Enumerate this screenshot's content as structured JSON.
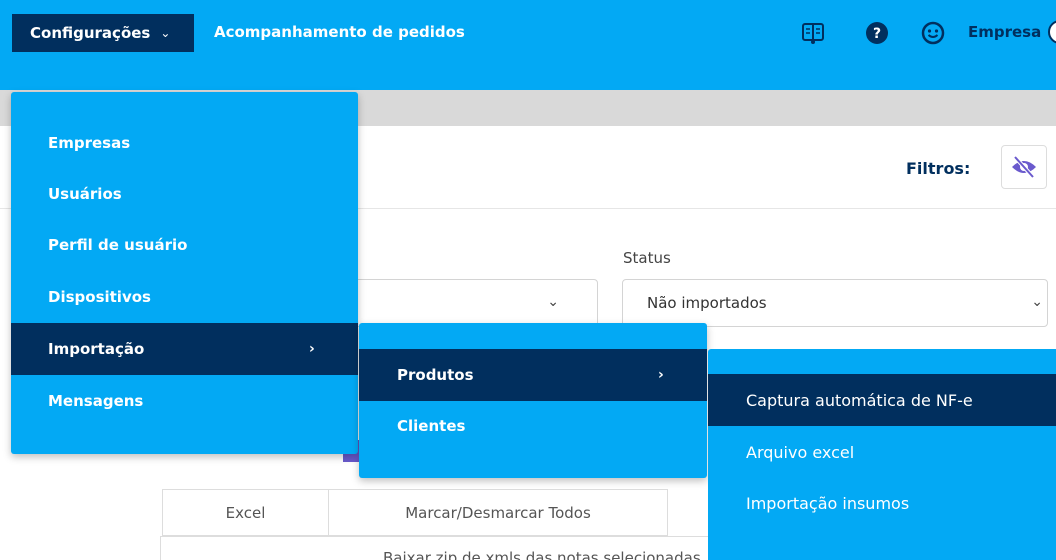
{
  "topbar": {
    "config_label": "Configurações",
    "nav_link": "Acompanhamento de pedidos",
    "company_label": "Empresa",
    "icons": [
      "book-icon",
      "help-icon",
      "smiley-icon"
    ],
    "bg_color": "#03a9f4",
    "dark_color": "#012f5e"
  },
  "filters": {
    "label": "Filtros:",
    "status_label": "Status",
    "status_value": "Não importados",
    "toggle_icon": "eye-slash-icon"
  },
  "table": {
    "buttons": [
      "Excel",
      "Marcar/Desmarcar Todos"
    ],
    "row_text": "Baixar zip de xmls das notas selecionadas"
  },
  "menu_level1": {
    "items": [
      "Empresas",
      "Usuários",
      "Perfil de usuário",
      "Dispositivos",
      "Importação",
      "Mensagens"
    ],
    "active": "Importação"
  },
  "menu_level2": {
    "items": [
      "Produtos",
      "Clientes"
    ],
    "active": "Produtos"
  },
  "menu_level3": {
    "items": [
      "Captura automática de NF-e",
      "Arquivo excel",
      "Importação insumos"
    ],
    "active": "Captura automática de NF-e"
  }
}
